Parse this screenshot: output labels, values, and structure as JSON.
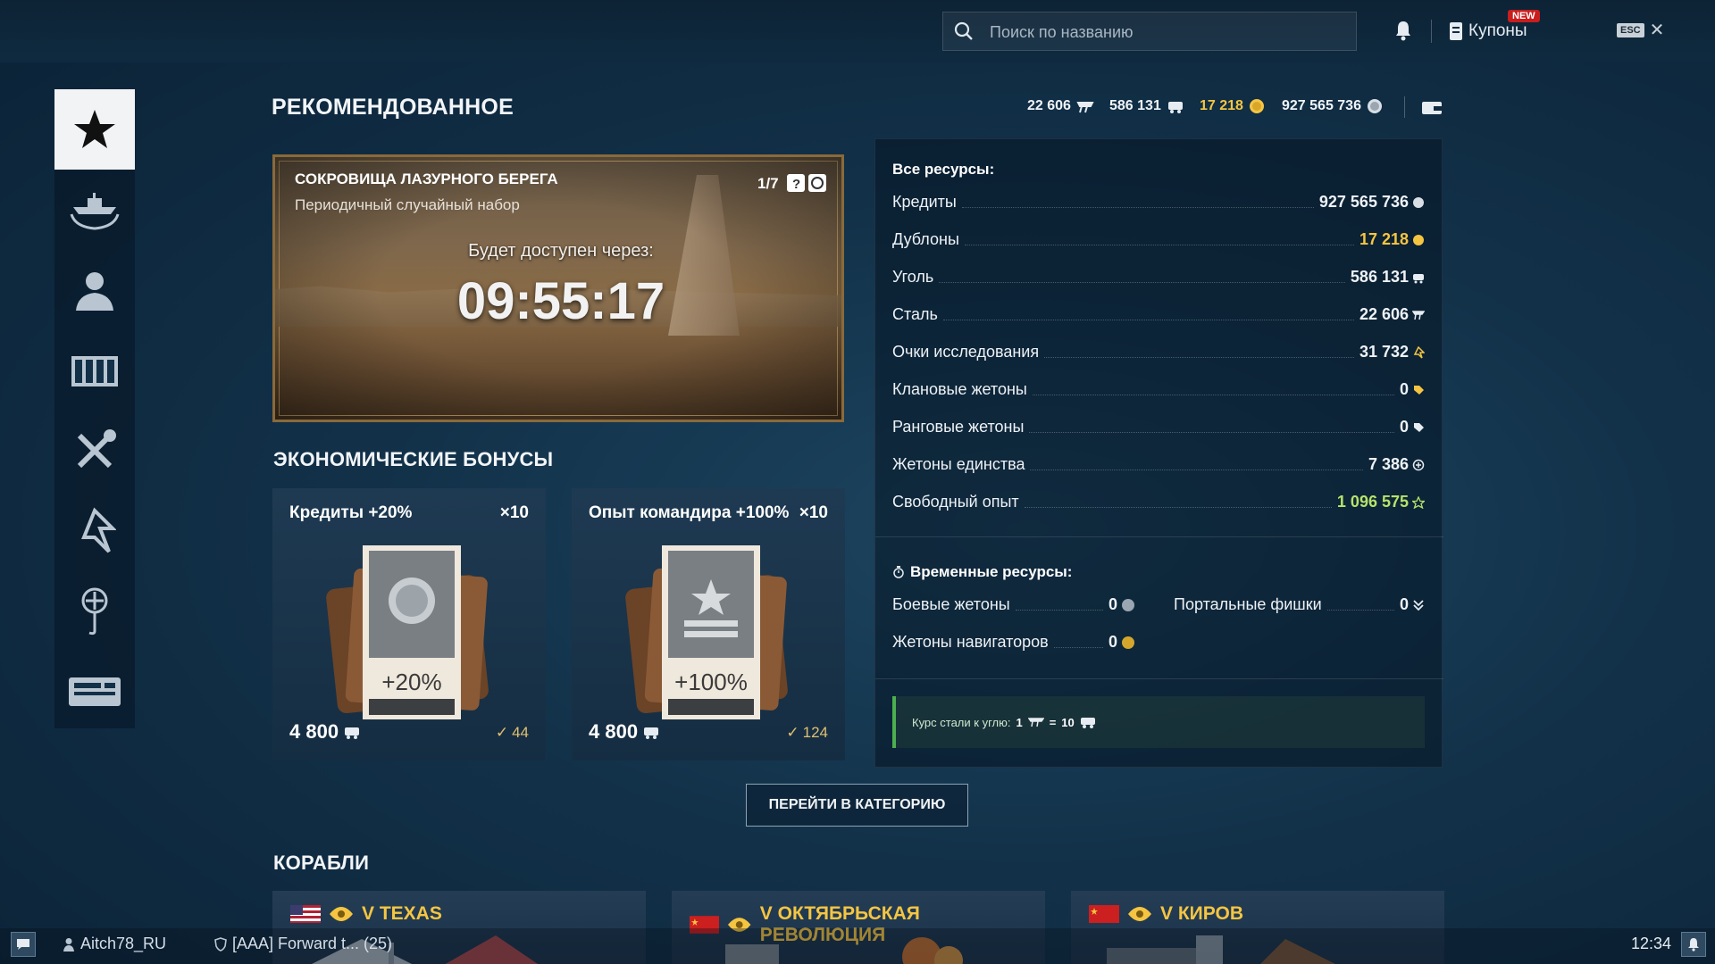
{
  "topbar": {
    "search_placeholder": "Поиск по названию",
    "coupons_label": "Купоны",
    "new_badge": "NEW",
    "esc_label": "ESC"
  },
  "sidebar": {
    "items": [
      {
        "icon": "star-icon",
        "active": true
      },
      {
        "icon": "ship-wreath-icon",
        "active": false
      },
      {
        "icon": "commander-icon",
        "active": false
      },
      {
        "icon": "container-icon",
        "active": false
      },
      {
        "icon": "tools-icon",
        "active": false
      },
      {
        "icon": "research-icon",
        "active": false
      },
      {
        "icon": "flag-emblem-icon",
        "active": false
      },
      {
        "icon": "console-icon",
        "active": false
      }
    ]
  },
  "header": {
    "title": "РЕКОМЕНДОВАННОЕ",
    "steel": "22 606",
    "coal": "586 131",
    "doubloons": "17 218",
    "credits": "927 565 736"
  },
  "banner": {
    "title": "СОКРОВИЩА ЛАЗУРНОГО БЕРЕГА",
    "subtitle": "Периодичный случайный набор",
    "count": "1/7",
    "available_label": "Будет доступен через:",
    "timer": "09:55:17"
  },
  "economic": {
    "title": "ЭКОНОМИЧЕСКИЕ БОНУСЫ",
    "cards": [
      {
        "title": "Кредиты +20%",
        "mult": "×10",
        "badge": "+20%",
        "price": "4 800",
        "owned": "44"
      },
      {
        "title": "Опыт командира +100%",
        "mult": "×10",
        "badge": "+100%",
        "price": "4 800",
        "owned": "124"
      }
    ]
  },
  "resources": {
    "all_title": "Все ресурсы:",
    "rows": [
      {
        "label": "Кредиты",
        "value": "927 565 736",
        "color": "#ffffff",
        "icon": "credits-icon"
      },
      {
        "label": "Дублоны",
        "value": "17 218",
        "color": "#f5c542",
        "icon": "doubloon-icon"
      },
      {
        "label": "Уголь",
        "value": "586 131",
        "color": "#ffffff",
        "icon": "coal-icon"
      },
      {
        "label": "Сталь",
        "value": "22 606",
        "color": "#ffffff",
        "icon": "steel-icon"
      },
      {
        "label": "Очки исследования",
        "value": "31 732",
        "color": "#ffffff",
        "icon": "research-points-icon"
      },
      {
        "label": "Клановые жетоны",
        "value": "0",
        "color": "#ffffff",
        "icon": "clan-token-icon"
      },
      {
        "label": "Ранговые жетоны",
        "value": "0",
        "color": "#ffffff",
        "icon": "rank-token-icon"
      },
      {
        "label": "Жетоны единства",
        "value": "7 386",
        "color": "#ffffff",
        "icon": "unity-token-icon"
      },
      {
        "label": "Свободный опыт",
        "value": "1 096 575",
        "color": "#b6e36b",
        "icon": "free-xp-icon"
      }
    ],
    "temp_title": "Временные ресурсы:",
    "temp_rows": [
      {
        "label": "Боевые жетоны",
        "value": "0"
      },
      {
        "label": "Портальные фишки",
        "value": "0"
      },
      {
        "label": "Жетоны навигаторов",
        "value": "0"
      }
    ],
    "rate_label": "Курс стали к углю:",
    "rate_from": "1",
    "rate_eq": "=",
    "rate_to": "10"
  },
  "category_button": "ПЕРЕЙТИ В КАТЕГОРИЮ",
  "ships": {
    "title": "КОРАБЛИ",
    "items": [
      {
        "name": "V TEXAS",
        "flag": "us"
      },
      {
        "name": "V ОКТЯБРЬСКАЯ РЕВОЛЮЦИЯ",
        "flag": "ussr"
      },
      {
        "name": "V КИРОВ",
        "flag": "ussr"
      }
    ]
  },
  "bottombar": {
    "player": "Aitch78_RU",
    "clan": "[AAA] Forward t... (25)",
    "clock": "12:34"
  },
  "colors": {
    "accent_gold": "#f5c542",
    "free_xp": "#b6e36b",
    "rate_green": "#4caf50"
  }
}
